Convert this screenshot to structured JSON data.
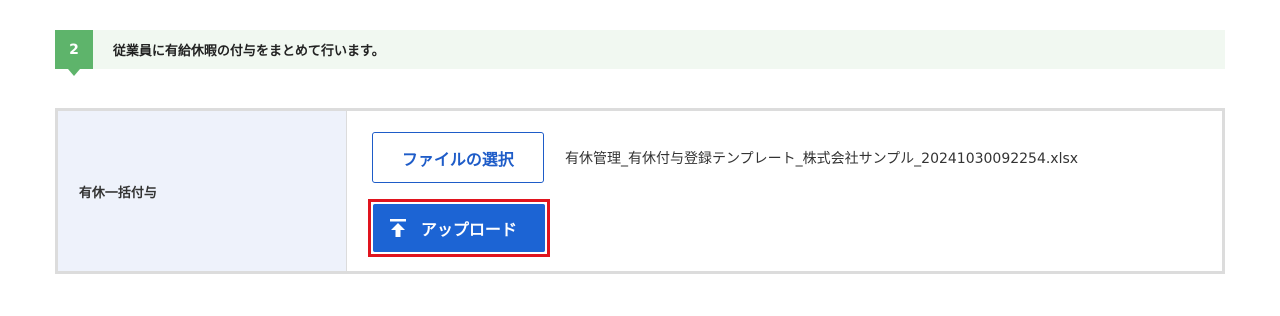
{
  "step": {
    "number": "2",
    "description": "従業員に有給休暇の付与をまとめて行います。"
  },
  "form": {
    "label": "有休一括付与",
    "file_select_label": "ファイルの選択",
    "file_name": "有休管理_有休付与登録テンプレート_株式会社サンプル_20241030092254.xlsx",
    "upload_label": "アップロード",
    "upload_icon": "upload-arrow-icon"
  },
  "colors": {
    "step_badge": "#5eb46b",
    "step_bar": "#f1f8f1",
    "primary": "#1c64d4",
    "highlight": "#e0141e",
    "label_bg": "#eef2fb"
  }
}
